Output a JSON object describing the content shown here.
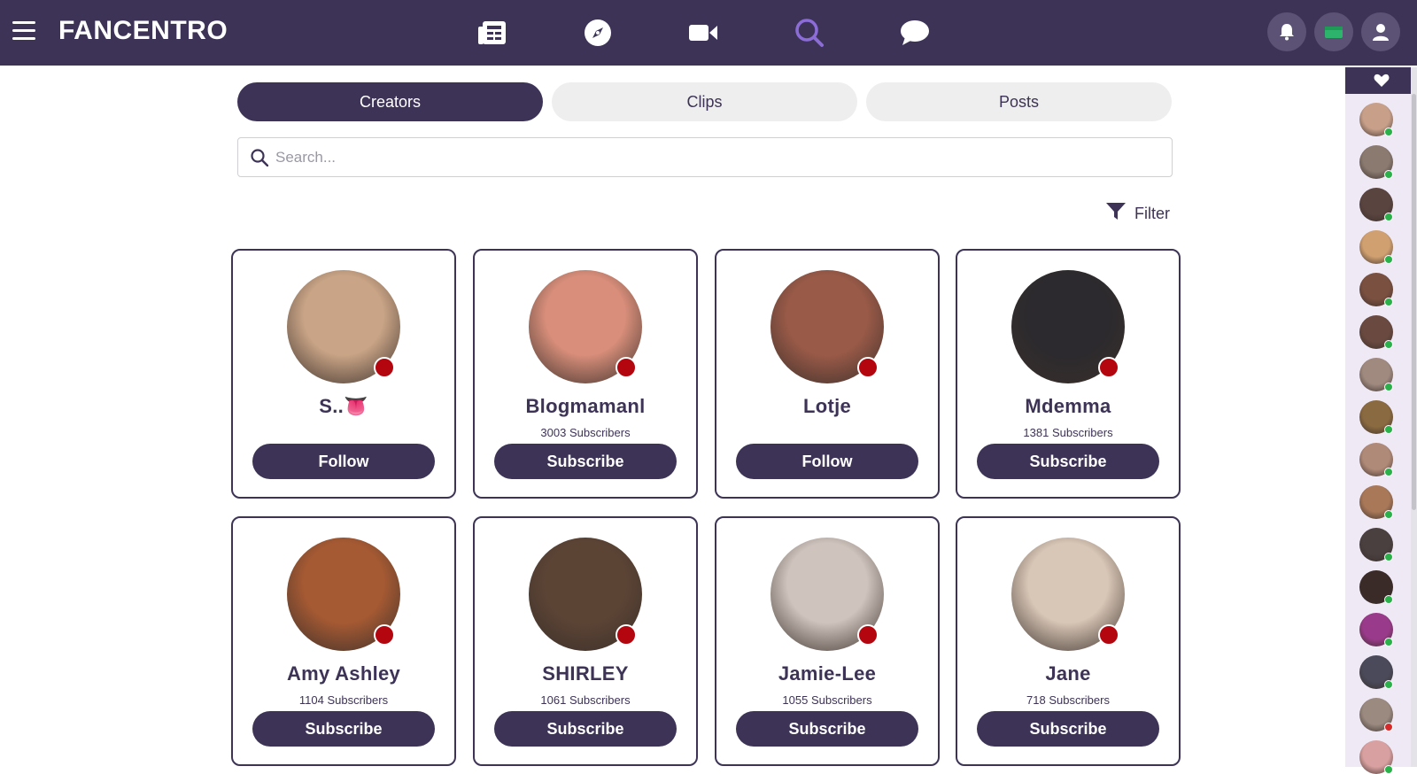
{
  "header": {
    "logo": "FANCENTRO",
    "nav_icons": [
      "feed-icon",
      "compass-icon",
      "video-icon",
      "search-icon",
      "chat-icon"
    ],
    "active_nav": "search-icon",
    "colors": {
      "bar": "#3d3356",
      "active_icon": "#8c6dd8",
      "wallet": "#2db36b"
    }
  },
  "tabs": [
    {
      "label": "Creators",
      "active": true
    },
    {
      "label": "Clips",
      "active": false
    },
    {
      "label": "Posts",
      "active": false
    }
  ],
  "search": {
    "placeholder": "Search...",
    "value": ""
  },
  "filter": {
    "label": "Filter"
  },
  "creators": [
    {
      "name": "S..👅",
      "subscribers": "",
      "button": "Follow",
      "avatar_color": "#c9a486"
    },
    {
      "name": "Blogmamanl",
      "subscribers": "3003 Subscribers",
      "button": "Subscribe",
      "avatar_color": "#d88e7a"
    },
    {
      "name": "Lotje",
      "subscribers": "",
      "button": "Follow",
      "avatar_color": "#9a5a48"
    },
    {
      "name": "Mdemma",
      "subscribers": "1381 Subscribers",
      "button": "Subscribe",
      "avatar_color": "#2c2a2e"
    },
    {
      "name": "Amy Ashley",
      "subscribers": "1104 Subscribers",
      "button": "Subscribe",
      "avatar_color": "#a65a33"
    },
    {
      "name": "SHIRLEY",
      "subscribers": "1061 Subscribers",
      "button": "Subscribe",
      "avatar_color": "#5c4435"
    },
    {
      "name": "Jamie-Lee",
      "subscribers": "1055 Subscribers",
      "button": "Subscribe",
      "avatar_color": "#cfc4bd"
    },
    {
      "name": "Jane",
      "subscribers": "718 Subscribers",
      "button": "Subscribe",
      "avatar_color": "#d8c6b6"
    }
  ],
  "sidebar": {
    "header_icon": "heart-icon",
    "avatars": [
      {
        "color": "#c8a08a",
        "status": "online"
      },
      {
        "color": "#8a7a70",
        "status": "online"
      },
      {
        "color": "#5a4440",
        "status": "online"
      },
      {
        "color": "#d0a070",
        "status": "online"
      },
      {
        "color": "#7a5040",
        "status": "online"
      },
      {
        "color": "#6a4a40",
        "status": "online"
      },
      {
        "color": "#a08a80",
        "status": "online"
      },
      {
        "color": "#8a6a40",
        "status": "online"
      },
      {
        "color": "#b08a78",
        "status": "online"
      },
      {
        "color": "#a87858",
        "status": "online"
      },
      {
        "color": "#4a4040",
        "status": "online"
      },
      {
        "color": "#3a2a28",
        "status": "online"
      },
      {
        "color": "#9a3a8a",
        "status": "online"
      },
      {
        "color": "#4a4a5a",
        "status": "online"
      },
      {
        "color": "#9a8a80",
        "status": "away"
      },
      {
        "color": "#d8a0a0",
        "status": "online"
      }
    ]
  }
}
